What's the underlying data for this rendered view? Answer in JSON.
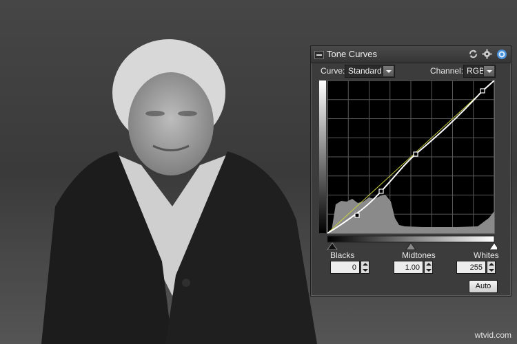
{
  "panel": {
    "title": "Tone Curves",
    "curve_label": "Curve:",
    "curve_value": "Standard",
    "channel_label": "Channel:",
    "channel_value": "RGB",
    "blacks_label": "Blacks",
    "midtones_label": "Midtones",
    "whites_label": "Whites",
    "blacks_value": "0",
    "midtones_value": "1.00",
    "whites_value": "255",
    "auto_label": "Auto",
    "icons": [
      "collapse-icon",
      "reset-icon",
      "gear-icon",
      "target-icon"
    ]
  },
  "watermark": "wtvid.com",
  "colors": {
    "panel_bg": "#3c3c3c",
    "curve": "#ffffff",
    "baseline": "#c8d040",
    "accent": "#4a90d9"
  }
}
